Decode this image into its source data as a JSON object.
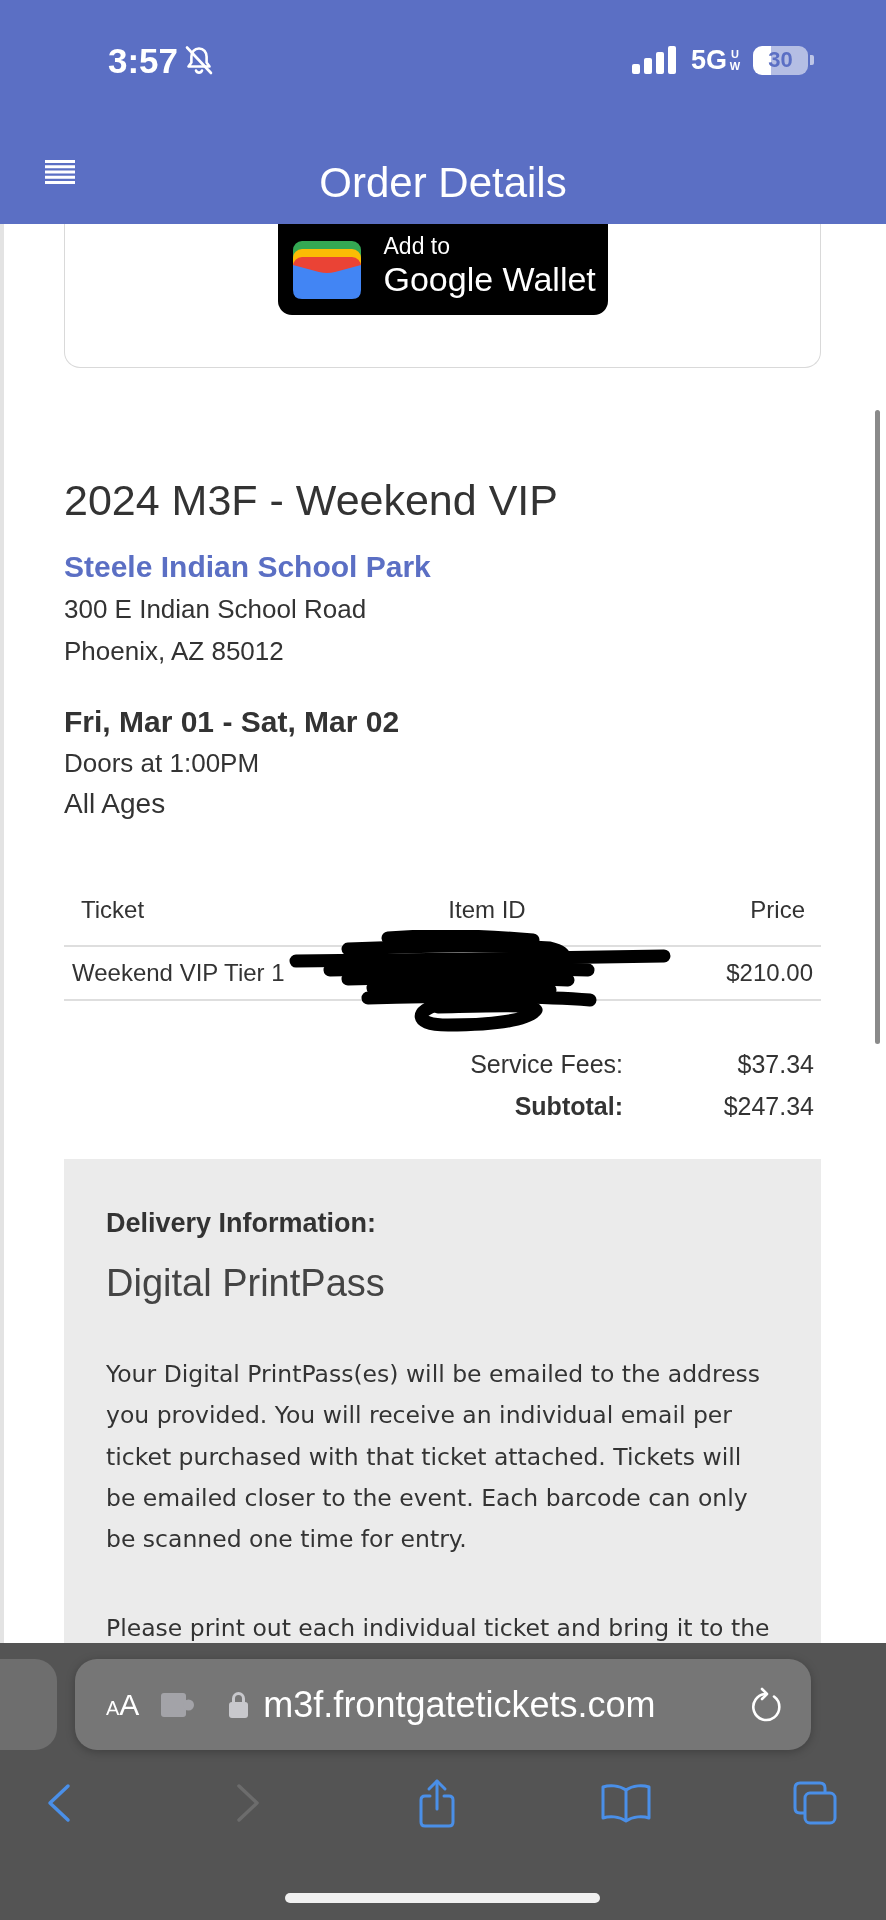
{
  "status_bar": {
    "time": "3:57",
    "silent": true,
    "network": "5G",
    "network_badge": "UW",
    "battery": "30"
  },
  "header": {
    "title": "Order Details"
  },
  "wallet_button": {
    "caption": "Add to",
    "label": "Google Wallet"
  },
  "event": {
    "title": "2024 M3F - Weekend VIP",
    "venue": "Steele Indian School Park",
    "address_lines": [
      "300 E Indian School Road",
      "Phoenix, AZ 85012"
    ],
    "dates": "Fri, Mar 01 - Sat, Mar 02",
    "doors": "Doors at 1:00PM",
    "ages": "All Ages"
  },
  "tickets_table": {
    "columns": [
      "Ticket",
      "Item ID",
      "Price"
    ],
    "rows": [
      {
        "ticket": "Weekend VIP Tier 1",
        "item_id_redacted": true,
        "price": "$210.00"
      }
    ]
  },
  "totals": [
    {
      "label": "Service Fees:",
      "value": "$37.34",
      "bold": false
    },
    {
      "label": "Subtotal:",
      "value": "$247.34",
      "bold": true
    }
  ],
  "delivery": {
    "heading": "Delivery Information:",
    "method": "Digital PrintPass",
    "paragraphs": [
      "Your Digital PrintPass(es) will be emailed to the address you provided. You will receive an individual email per ticket purchased with that ticket attached. Tickets will be emailed closer to the event. Each barcode can only be scanned one time for entry.",
      "Please print out each individual ticket and bring it to the"
    ]
  },
  "browser": {
    "text_size_button": "AA",
    "url": "m3f.frontgatetickets.com",
    "toolbar": [
      {
        "kind": "back",
        "disabled": false
      },
      {
        "kind": "forward",
        "disabled": true
      },
      {
        "kind": "share",
        "disabled": false
      },
      {
        "kind": "bookmarks",
        "disabled": false
      },
      {
        "kind": "tabs",
        "disabled": false
      }
    ]
  }
}
